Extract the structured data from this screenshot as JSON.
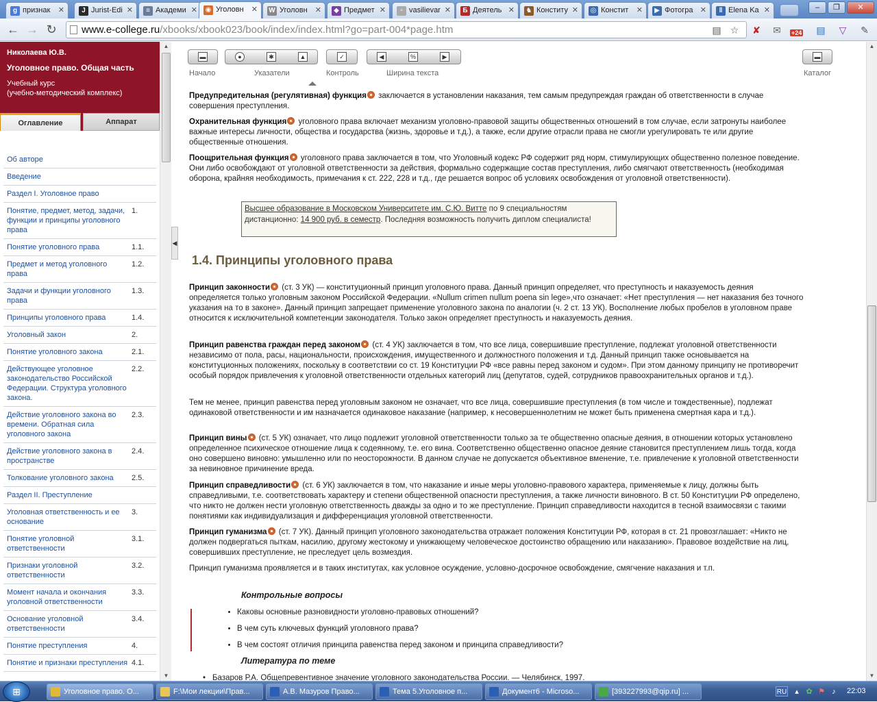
{
  "browser": {
    "tabs": [
      {
        "label": "признак",
        "icon": "google-favicon",
        "color": "#4a7bd6",
        "glyph": "g"
      },
      {
        "label": "Jurist-Edi",
        "icon": "jurist-favicon",
        "color": "#2a2a2a",
        "glyph": "J"
      },
      {
        "label": "Академи",
        "icon": "book-favicon",
        "color": "#6a7c99",
        "glyph": "≡"
      },
      {
        "label": "Уголовн",
        "icon": "college-favicon",
        "color": "#d96a2b",
        "glyph": "◉",
        "active": true
      },
      {
        "label": "Уголовн",
        "icon": "wikipedia-favicon",
        "color": "#888888",
        "glyph": "W"
      },
      {
        "label": "Предмет",
        "icon": "cube-favicon",
        "color": "#7a3fa0",
        "glyph": "◆"
      },
      {
        "label": "vasilievar",
        "icon": "page-favicon",
        "color": "#aaaaaa",
        "glyph": "▫"
      },
      {
        "label": "Деятель",
        "icon": "b-favicon",
        "color": "#b02a2a",
        "glyph": "Б"
      },
      {
        "label": "Конститу",
        "icon": "emblem-favicon",
        "color": "#8a5a2a",
        "glyph": "♞"
      },
      {
        "label": "Констит",
        "icon": "globe-favicon",
        "color": "#3a6ab0",
        "glyph": "◎"
      },
      {
        "label": "Фотогра",
        "icon": "play-favicon",
        "color": "#3a6ab0",
        "glyph": "▶"
      },
      {
        "label": "Elena Ka",
        "icon": "pause-favicon",
        "color": "#3a6ab0",
        "glyph": "‖"
      }
    ],
    "window_buttons": [
      "–",
      "❐",
      "✕"
    ],
    "url_host": "www.e-college.ru",
    "url_path": "/xbooks/xbook023/book/index/index.html?go=part-004*page.htm",
    "badge": "+24"
  },
  "sidebar": {
    "author": "Николаева Ю.В.",
    "book_title": "Уголовное право. Общая часть",
    "kind_line1": "Учебный курс",
    "kind_line2": "(учебно-методический комплекс)",
    "tab_contents": "Оглавление",
    "tab_apparatus": "Аппарат",
    "toc": [
      {
        "label": "Об авторе",
        "num": ""
      },
      {
        "label": "Введение",
        "num": ""
      },
      {
        "label": "Раздел I. Уголовное право",
        "num": ""
      },
      {
        "label": "Понятие, предмет, метод, задачи, функции и принципы уголовного права",
        "num": "1."
      },
      {
        "label": "Понятие уголовного права",
        "num": "1.1."
      },
      {
        "label": "Предмет и метод уголовного права",
        "num": "1.2."
      },
      {
        "label": "Задачи и функции уголовного права",
        "num": "1.3."
      },
      {
        "label": "Принципы уголовного права",
        "num": "1.4."
      },
      {
        "label": "Уголовный закон",
        "num": "2."
      },
      {
        "label": "Понятие уголовного закона",
        "num": "2.1."
      },
      {
        "label": "Действующее уголовное законодательство Российской Федерации. Структура уголовного закона.",
        "num": "2.2."
      },
      {
        "label": "Действие уголовного закона во времени. Обратная сила уголовного закона",
        "num": "2.3."
      },
      {
        "label": "Действие уголовного закона в пространстве",
        "num": "2.4."
      },
      {
        "label": "Толкование уголовного закона",
        "num": "2.5."
      },
      {
        "label": "Раздел II. Преступление",
        "num": ""
      },
      {
        "label": "Уголовная ответственность и ее основание",
        "num": "3."
      },
      {
        "label": "Понятие уголовной ответственности",
        "num": "3.1."
      },
      {
        "label": "Признаки уголовной ответственности",
        "num": "3.2."
      },
      {
        "label": "Момент начала и окончания уголовной ответственности",
        "num": "3.3."
      },
      {
        "label": "Основание уголовной ответственности",
        "num": "3.4."
      },
      {
        "label": "Понятие преступления",
        "num": "4."
      },
      {
        "label": "Понятие и признаки преступления",
        "num": "4.1."
      }
    ]
  },
  "booktoolbar": {
    "start": "Начало",
    "pointers": "Указатели",
    "control": "Контроль",
    "text_width": "Ширина текста",
    "catalog": "Каталог"
  },
  "content": {
    "p1_bold": "Предупредительная (регулятивная) функция",
    "p1_rest": " заключается в установлении наказания, тем самым предупреждая граждан об ответственности в случае совершения преступления.",
    "p2_bold": "Охранительная функция",
    "p2_rest": " уголовного права включает механизм уголовно-правовой защиты общественных отношений в том случае, если затронуты наиболее важные интересы личности, общества и государства (жизнь, здоровье и т.д.), а также, если другие отрасли права не смогли урегулировать те или другие общественные отношения.",
    "p3_bold": "Поощрительная функция",
    "p3_rest": " уголовного права заключается в том, что Уголовный кодекс РФ содержит ряд норм, стимулирующих общественно полезное поведение. Они либо освобождают от уголовной ответственности за действия, формально содержащие состав преступления, либо смягчают ответственность (необходимая оборона, крайняя необходимость, примечания к ст. 222, 228 и т.д., где решается вопрос об условиях освобождения от уголовной ответственности).",
    "ad_link": "Высшее образование в Московском Университете им. С.Ю. Витте",
    "ad_mid": " по 9 специальностям дистанционно: ",
    "ad_price": "14 900 руб. в семестр",
    "ad_end": ". Последняя возможность получить диплом специалиста!",
    "heading": "1.4. Принципы уголовного права",
    "p4_bold": "Принцип законности",
    "p4_rest": " (ст. 3 УК) — конституционный принцип уголовного права. Данный принцип определяет, что преступность и наказуемость деяния определяется только уголовным законом Российской Федерации. «Nullum crimen nullum poena sin lege»,что означает: «Нет преступления — нет наказания без точного указания на то в законе». Данный принцип запрещает применение уголовного закона по аналогии (ч. 2 ст. 13 УК). Восполнение любых пробелов в уголовном праве относится к исключительной компетенции законодателя. Только закон определяет преступность и наказуемость деяния.",
    "p5_bold": "Принцип равенства граждан перед законом",
    "p5_rest": " (ст. 4 УК) заключается в том, что все лица, совершившие преступление, подлежат уголовной ответственности независимо от пола, расы, национальности, происхождения, имущественного и должностного положения и т.д. Данный принцип также основывается на конституционных положениях, поскольку в соответствии со ст. 19 Конституции РФ «все равны перед законом и судом». При этом данному принципу не противоречит особый порядок привлечения к уголовной ответственности отдельных категорий лиц (депутатов, судей, сотрудников правоохранительных органов и т.д.).",
    "p6": "Тем не менее, принцип равенства перед уголовным законом не означает, что все лица, совершившие преступления (в том числе и тождественные), подлежат одинаковой ответственности и им назначается одинаковое наказание (например, к несовершеннолетним не может быть применена смертная кара и т.д.).",
    "p7_bold": "Принцип вины",
    "p7_rest": " (ст. 5 УК) означает, что лицо подлежит уголовной ответственности только за те общественно опасные деяния, в отношении которых установлено определенное психическое отношение лица к содеянному, т.е. его вина. Соответственно общественно опасное деяние становится преступлением лишь тогда, когда оно совершено виновно: умышленно или по неосторожности. В данном случае не допускается объективное вменение, т.е. привлечение к уголовной ответственности за невиновное причинение вреда.",
    "p8_bold": "Принцип справедливости",
    "p8_rest": " (ст. 6 УК) заключается в том, что наказание и иные меры уголовно-правового характера, применяемые к лицу, должны быть справедливыми, т.е. соответствовать характеру и степени общественной опасности преступления, а также личности виновного. В ст. 50 Конституции РФ определено, что никто не должен нести уголовную ответственность дважды за одно и то же преступление. Принцип справедливости находится в тесной взаимосвязи с такими понятиями как индивидуализация и дифференциация уголовной ответственности.",
    "p9_bold": "Принцип гуманизма",
    "p9_rest": " (ст. 7 УК). Данный принцип уголовного законодательства отражает положения Конституции РФ, которая в ст. 21 провозглашает: «Никто не должен подвергаться пыткам, насилию, другому жестокому и унижающему человеческое достоинство обращению или наказанию». Правовое воздействие на лиц, совершивших преступление, не преследует цель возмездия.",
    "p10": "Принцип гуманизма проявляется и в таких институтах, как условное осуждение, условно-досрочное освобождение, смягчение наказания и т.п.",
    "questions_title": "Контрольные вопросы",
    "questions": [
      "Каковы основные разновидности уголовно-правовых отношений?",
      "В чем суть ключевых функций уголовного права?",
      "В чем состоят отличия принципа равенства перед законом и принципа справедливости?"
    ],
    "literature_title": "Литература по теме",
    "literature_first": "Базаров Р.А. Общепревентивное значение уголовного законодательства России. — Челябинск, 1997."
  },
  "taskbar": {
    "start_glyph": "⊞",
    "tasks": [
      {
        "label": "Уголовное право. О...",
        "icon": "chrome-icon",
        "color": "#e0b93a",
        "active": true
      },
      {
        "label": "F:\\Мои лекции\\Прав...",
        "icon": "folder-icon",
        "color": "#e9c55a"
      },
      {
        "label": "А.В. Мазуров Право...",
        "icon": "word-icon",
        "color": "#2b5fb4"
      },
      {
        "label": "Тема 5.Уголовное п...",
        "icon": "word-icon",
        "color": "#2b5fb4"
      },
      {
        "label": "Документ6 - Microso...",
        "icon": "word-icon",
        "color": "#2b5fb4"
      },
      {
        "label": "[393227993@qip.ru] ...",
        "icon": "qip-icon",
        "color": "#4aa84a"
      }
    ],
    "lang": "RU",
    "clock": "22:03"
  }
}
